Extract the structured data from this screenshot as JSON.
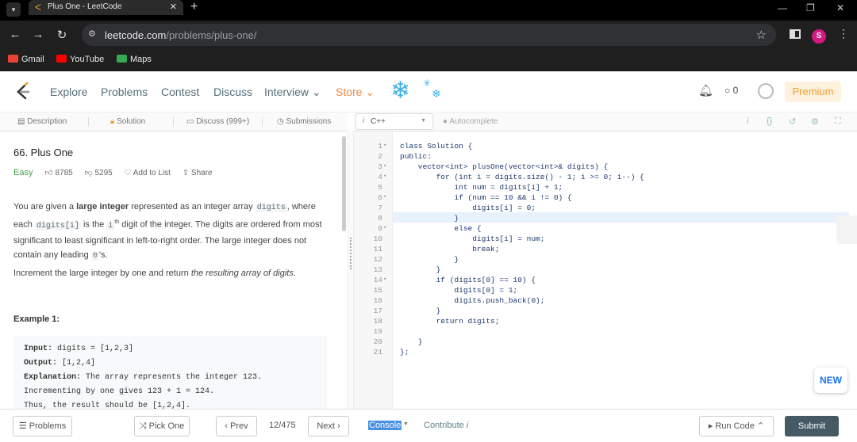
{
  "browser": {
    "tab_title": "Plus One - LeetCode",
    "url_host": "leetcode.com",
    "url_path": "/problems/plus-one/",
    "bookmarks": [
      {
        "label": "Gmail",
        "color": "#ea4335"
      },
      {
        "label": "YouTube",
        "color": "#ff0000"
      },
      {
        "label": "Maps",
        "color": "#34a853"
      }
    ],
    "profile_initial": "S"
  },
  "header": {
    "nav": [
      "Explore",
      "Problems",
      "Contest",
      "Discuss",
      "Interview",
      "Store"
    ],
    "notification_count": "0",
    "premium_label": "Premium",
    "brand_color": "#f0883e"
  },
  "subtabs": [
    "Description",
    "Solution",
    "Discuss (999+)",
    "Submissions"
  ],
  "editor_bar": {
    "language": "C++",
    "autocomplete": "Autocomplete"
  },
  "problem": {
    "title": "66. Plus One",
    "difficulty": "Easy",
    "likes": "8785",
    "dislikes": "5295",
    "add_to_list": "Add to List",
    "share": "Share",
    "p1_a": "You are given a ",
    "p1_bold": "large integer",
    "p1_b": " represented as an integer array ",
    "p1_code1": "digits",
    "p1_c": ", where each ",
    "p1_code2": "digits[i]",
    "p1_d": " is the ",
    "p1_sup_base": "i",
    "p1_sup": "th",
    "p1_e": " digit of the integer. The digits are ordered from most significant to least significant in left-to-right order. The large integer does not contain any leading ",
    "p1_code3": "0",
    "p1_f": "'s.",
    "p2_a": "Increment the large integer by one and return ",
    "p2_italic": "the resulting array of digits",
    "p2_b": ".",
    "example_heading": "Example 1:",
    "example_lines": [
      {
        "label": "Input:",
        "text": " digits = [1,2,3]"
      },
      {
        "label": "Output:",
        "text": " [1,2,4]"
      },
      {
        "label": "Explanation:",
        "text": " The array represents the integer 123."
      },
      {
        "label": "",
        "text": "Incrementing by one gives 123 + 1 = 124."
      },
      {
        "label": "",
        "text": "Thus, the result should be [1,2,4]."
      }
    ]
  },
  "code_lines": [
    {
      "n": "1",
      "fold": "▾",
      "code": "class Solution {"
    },
    {
      "n": "2",
      "fold": "",
      "code": "public:"
    },
    {
      "n": "3",
      "fold": "▾",
      "code": "    vector<int> plusOne(vector<int>& digits) {"
    },
    {
      "n": "4",
      "fold": "▾",
      "code": "        for (int i = digits.size() - 1; i >= 0; i--) {"
    },
    {
      "n": "5",
      "fold": "",
      "code": "            int num = digits[i] + 1;"
    },
    {
      "n": "6",
      "fold": "▾",
      "code": "            if (num == 10 && i != 0) {"
    },
    {
      "n": "7",
      "fold": "",
      "code": "                digits[i] = 0;"
    },
    {
      "n": "8",
      "fold": "",
      "code": "            }"
    },
    {
      "n": "9",
      "fold": "▾",
      "code": "            else {"
    },
    {
      "n": "10",
      "fold": "",
      "code": "                digits[i] = num;"
    },
    {
      "n": "11",
      "fold": "",
      "code": "                break;"
    },
    {
      "n": "12",
      "fold": "",
      "code": "            }"
    },
    {
      "n": "13",
      "fold": "",
      "code": "        }"
    },
    {
      "n": "14",
      "fold": "▾",
      "code": "        if (digits[0] == 10) {"
    },
    {
      "n": "15",
      "fold": "",
      "code": "            digits[0] = 1;"
    },
    {
      "n": "16",
      "fold": "",
      "code": "            digits.push_back(0);"
    },
    {
      "n": "17",
      "fold": "",
      "code": "        }"
    },
    {
      "n": "18",
      "fold": "",
      "code": "        return digits;"
    },
    {
      "n": "19",
      "fold": "",
      "code": ""
    },
    {
      "n": "20",
      "fold": "",
      "code": "    }"
    },
    {
      "n": "21",
      "fold": "",
      "code": "};"
    }
  ],
  "new_badge": "NEW",
  "bottom": {
    "problems": "Problems",
    "pick_one": "Pick One",
    "prev": "Prev",
    "page_indicator": "12/475",
    "next": "Next",
    "console": "Console",
    "contribute": "Contribute",
    "run_code": "Run Code",
    "submit": "Submit"
  }
}
